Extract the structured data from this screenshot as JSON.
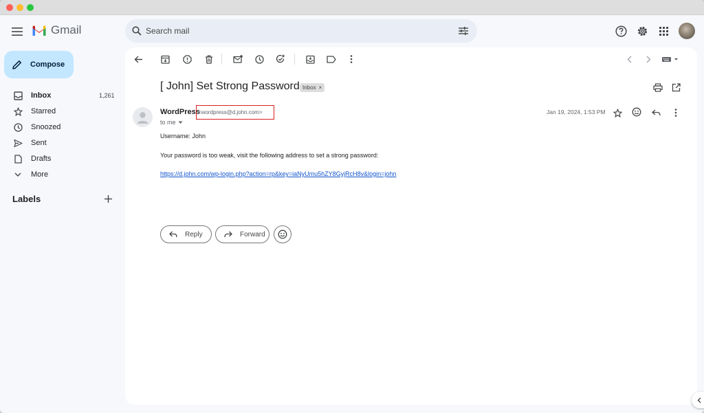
{
  "window": {
    "title": "Gmail"
  },
  "header": {
    "app_name": "Gmail",
    "search_placeholder": "Search mail"
  },
  "sidebar": {
    "compose_label": "Compose",
    "items": [
      {
        "label": "Inbox",
        "count": "1,261",
        "icon": "inbox-icon",
        "active": true
      },
      {
        "label": "Starred",
        "count": "",
        "icon": "star-icon"
      },
      {
        "label": "Snoozed",
        "count": "",
        "icon": "clock-icon"
      },
      {
        "label": "Sent",
        "count": "",
        "icon": "send-icon"
      },
      {
        "label": "Drafts",
        "count": "",
        "icon": "draft-icon"
      },
      {
        "label": "More",
        "count": "",
        "icon": "chevron-down-icon"
      }
    ],
    "labels_heading": "Labels"
  },
  "email": {
    "subject": "[ John] Set Strong Password",
    "label_badge": "Inbox",
    "badge_close": "×",
    "sender_name": "WordPress",
    "sender_email": "<wordpress@d.john.com>",
    "recipient": "to me",
    "date": "Jan 19, 2024, 1:53 PM",
    "body": {
      "line1": "Username: John",
      "line2": "Your password is too weak, visit the following address to set a strong password:",
      "link": "https://d.john.com/wp-login.php?action=rp&key=iaNyUmu5hZY8GyjRcH8v&login=john"
    },
    "reply_label": "Reply",
    "forward_label": "Forward"
  },
  "colors": {
    "compose_bg": "#c2e7ff",
    "search_bg": "#e9eef6",
    "highlight_box": "#d92020",
    "link": "#1155cc"
  }
}
